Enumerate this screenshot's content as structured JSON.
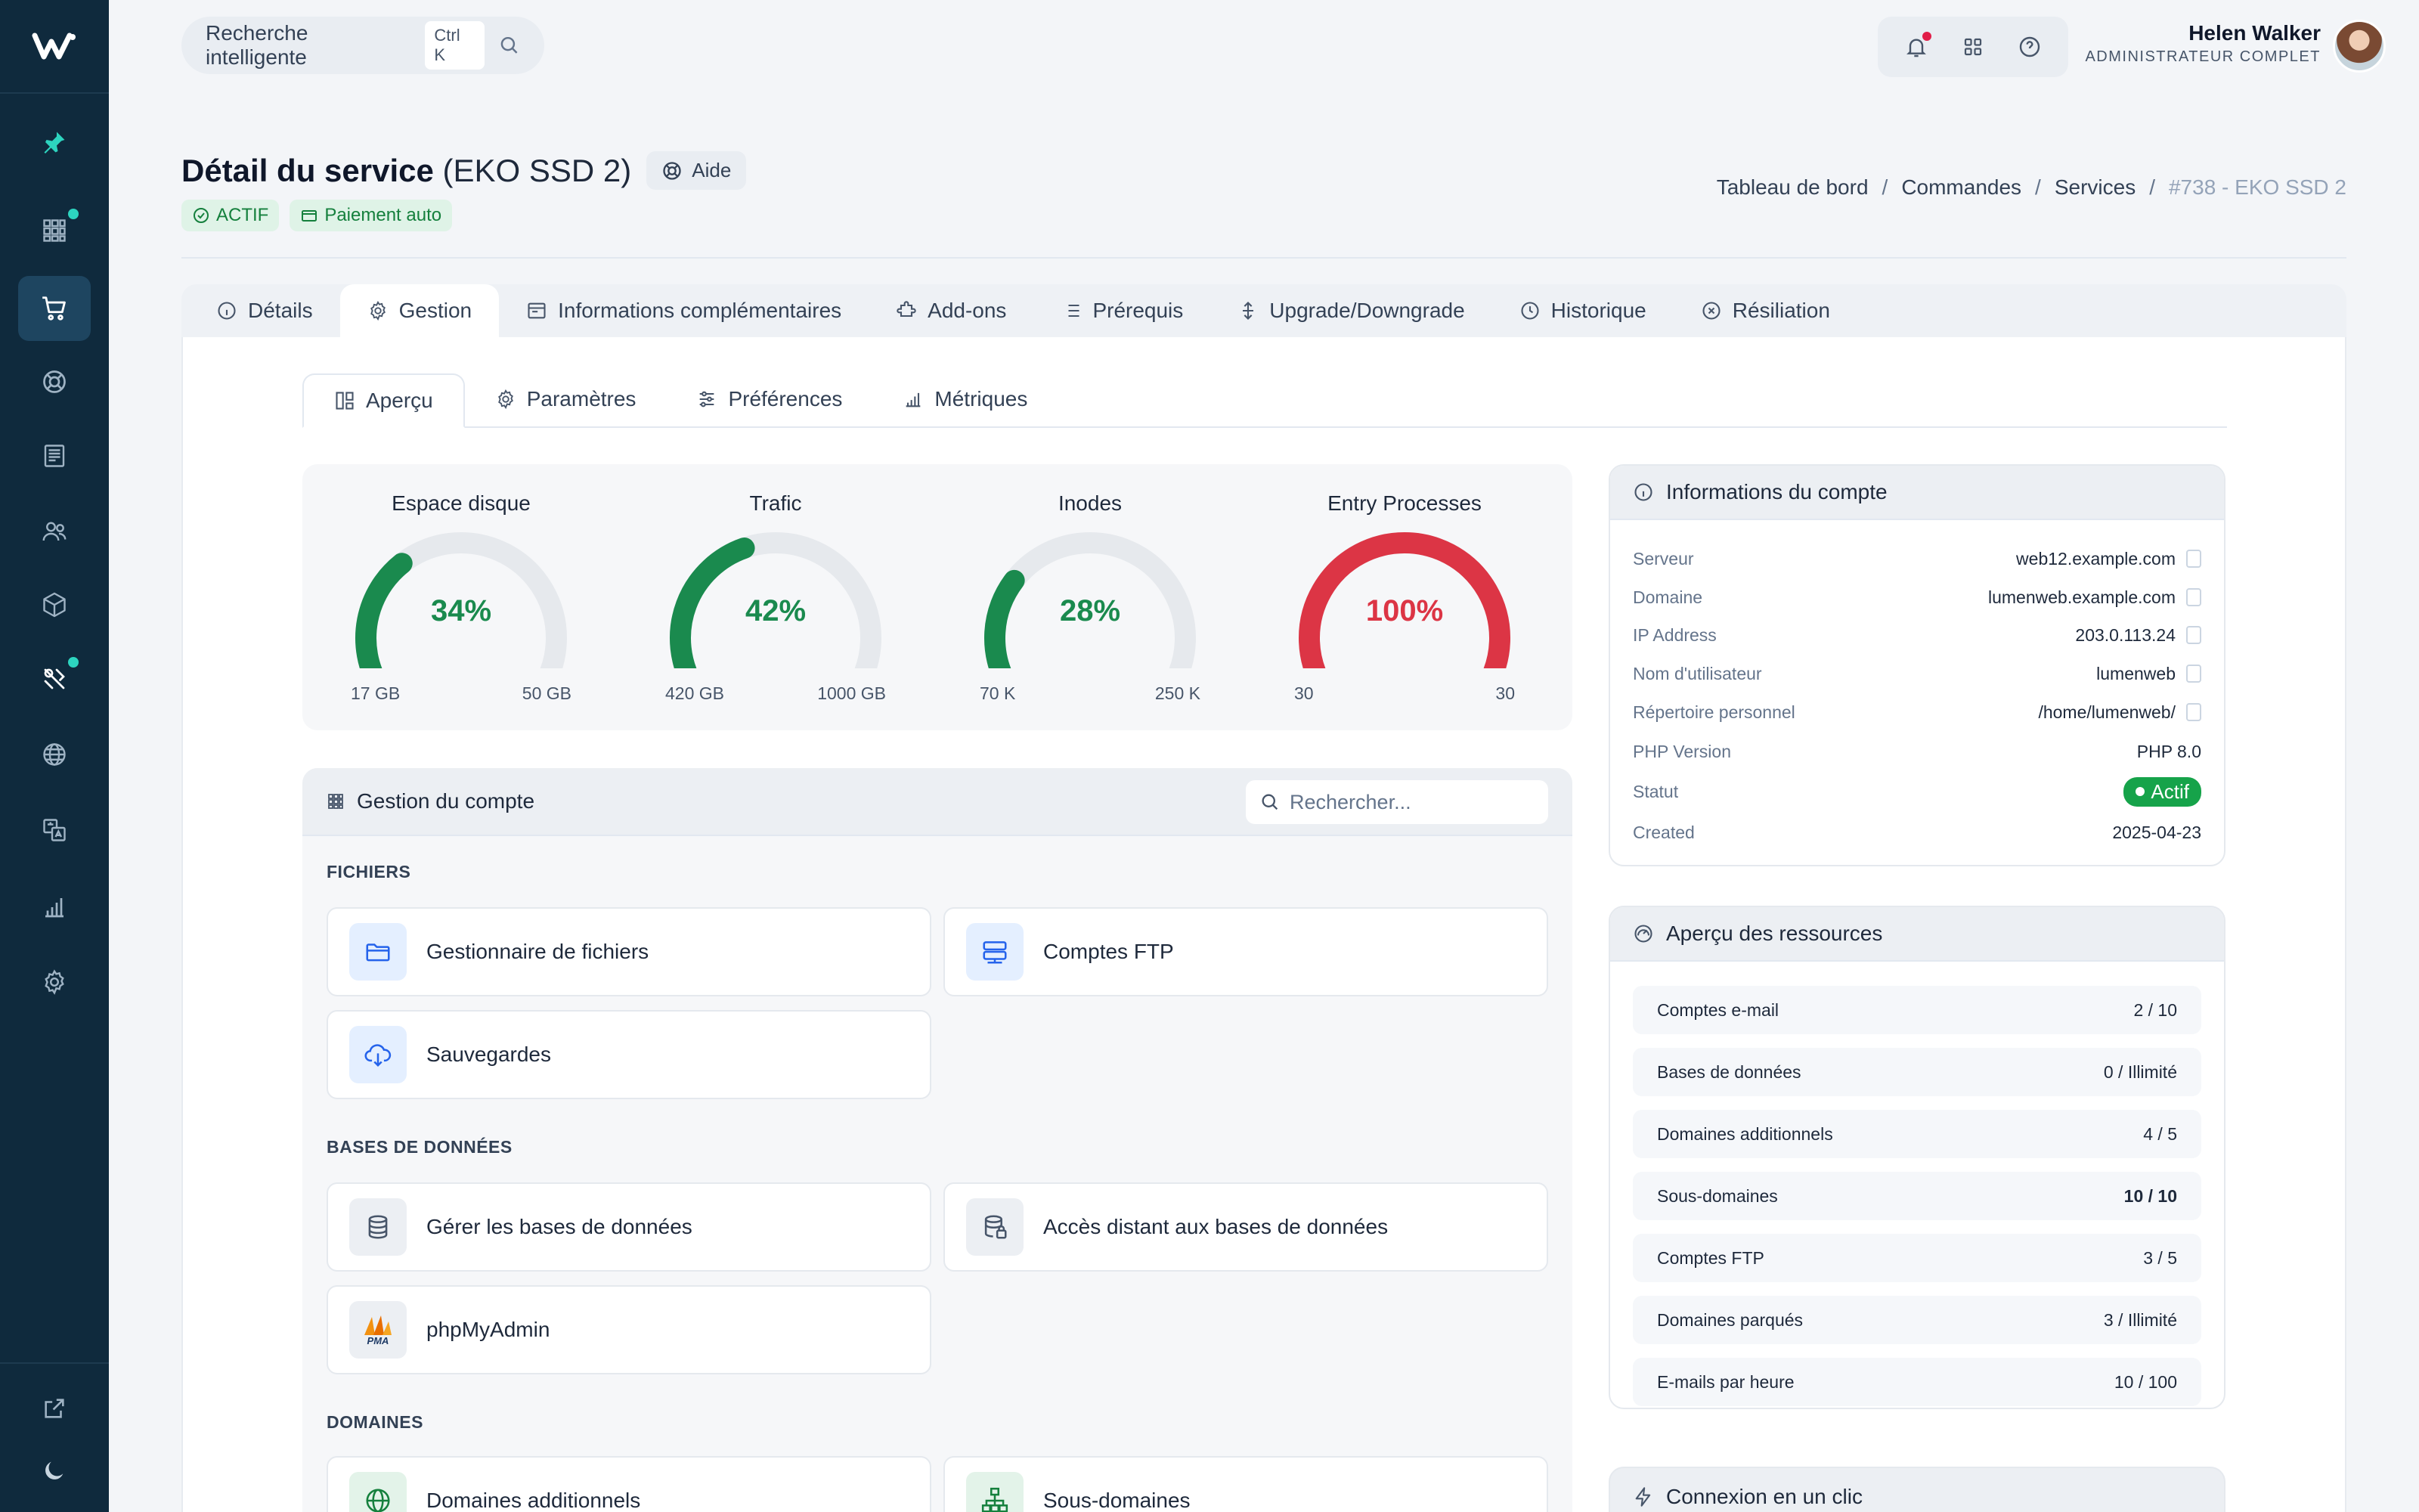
{
  "header": {
    "search_label": "Recherche intelligente",
    "search_shortcut": "Ctrl K",
    "user_name": "Helen Walker",
    "user_role": "ADMINISTRATEUR COMPLET"
  },
  "page": {
    "title": "Détail du service",
    "subtitle": "(EKO SSD 2)",
    "help_label": "Aide",
    "badges": [
      "ACTIF",
      "Paiement auto"
    ],
    "breadcrumb": [
      "Tableau de bord",
      "Commandes",
      "Services",
      "#738 - EKO SSD 2"
    ]
  },
  "main_tabs": [
    "Détails",
    "Gestion",
    "Informations complémentaires",
    "Add-ons",
    "Prérequis",
    "Upgrade/Downgrade",
    "Historique",
    "Résiliation"
  ],
  "sub_tabs": [
    "Aperçu",
    "Paramètres",
    "Préférences",
    "Métriques"
  ],
  "gauges": [
    {
      "title": "Espace disque",
      "percent_label": "34%",
      "value": 0.34,
      "min": "17 GB",
      "max": "50 GB",
      "color": "#1a8a4e"
    },
    {
      "title": "Trafic",
      "percent_label": "42%",
      "value": 0.42,
      "min": "420 GB",
      "max": "1000 GB",
      "color": "#1a8a4e"
    },
    {
      "title": "Inodes",
      "percent_label": "28%",
      "value": 0.28,
      "min": "70 K",
      "max": "250 K",
      "color": "#1a8a4e"
    },
    {
      "title": "Entry Processes",
      "percent_label": "100%",
      "value": 1.0,
      "min": "30",
      "max": "30",
      "color": "#dc3545"
    }
  ],
  "account_management": {
    "title": "Gestion du compte",
    "search_placeholder": "Rechercher...",
    "sections": [
      {
        "label": "FICHIERS",
        "items": [
          "Gestionnaire de fichiers",
          "Comptes FTP",
          "Sauvegardes"
        ]
      },
      {
        "label": "BASES DE DONNÉES",
        "items": [
          "Gérer les bases de données",
          "Accès distant aux bases de données",
          "phpMyAdmin"
        ]
      },
      {
        "label": "DOMAINES",
        "items": [
          "Domaines additionnels",
          "Sous-domaines"
        ]
      }
    ],
    "pma_logo_text": "PMA"
  },
  "account_info": {
    "title": "Informations du compte",
    "rows": [
      {
        "label": "Serveur",
        "value": "web12.example.com"
      },
      {
        "label": "Domaine",
        "value": "lumenweb.example.com"
      },
      {
        "label": "IP Address",
        "value": "203.0.113.24"
      },
      {
        "label": "Nom d'utilisateur",
        "value": "lumenweb"
      },
      {
        "label": "Répertoire personnel",
        "value": "/home/lumenweb/"
      },
      {
        "label": "PHP Version",
        "value": "PHP 8.0"
      },
      {
        "label": "Statut",
        "value": "Actif"
      },
      {
        "label": "Created",
        "value": "2025-04-23"
      }
    ]
  },
  "resources": {
    "title": "Aperçu des ressources",
    "rows": [
      {
        "label": "Comptes e-mail",
        "value": "2 / 10"
      },
      {
        "label": "Bases de données",
        "value": "0 / Illimité"
      },
      {
        "label": "Domaines additionnels",
        "value": "4 / 5"
      },
      {
        "label": "Sous-domaines",
        "value": "10 / 10"
      },
      {
        "label": "Comptes FTP",
        "value": "3 / 5"
      },
      {
        "label": "Domaines parqués",
        "value": "3 / Illimité"
      },
      {
        "label": "E-mails par heure",
        "value": "10 / 100"
      }
    ]
  },
  "one_click": {
    "title": "Connexion en un clic"
  },
  "colors": {
    "sidebar": "#0f2a3d",
    "accent_green": "#1a8a4e",
    "danger": "#dc3545",
    "status_active": "#16a34a"
  }
}
